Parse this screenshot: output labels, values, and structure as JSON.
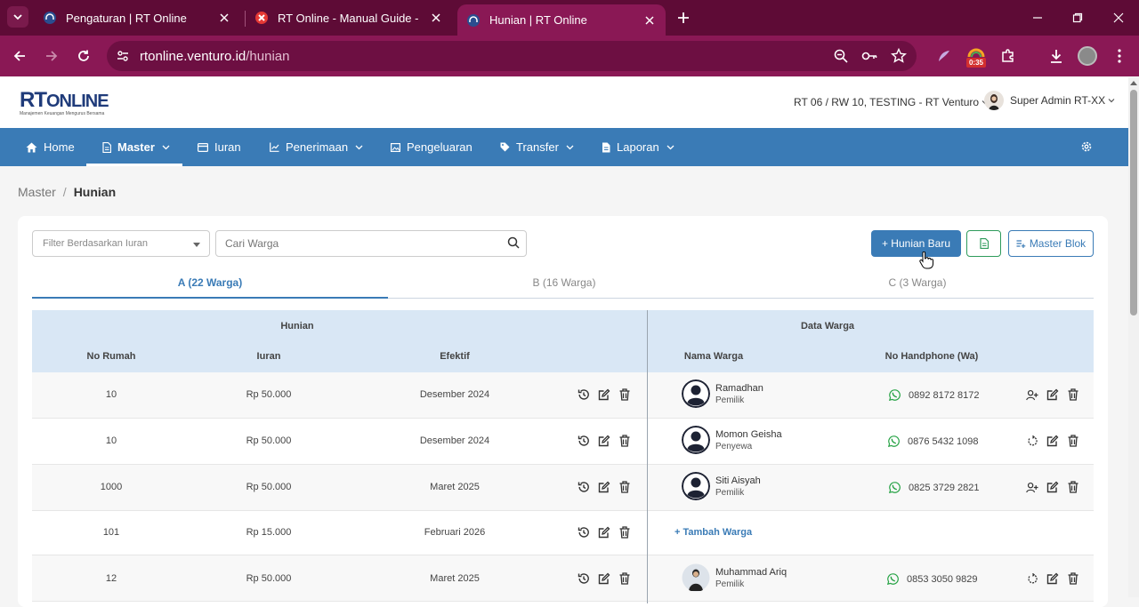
{
  "browser": {
    "tabs": [
      {
        "title": "Pengaturan | RT Online",
        "active": false
      },
      {
        "title": "RT Online - Manual Guide - Xm",
        "active": false
      },
      {
        "title": "Hunian | RT Online",
        "active": true
      }
    ],
    "url_host": "rtonline.venturo.id",
    "url_path": "/hunian",
    "timer_badge": "0:35"
  },
  "header": {
    "logo_text": "RT",
    "logo_text2": "ONLINE",
    "logo_tagline": "Manajemen Keuangan Mengurus Bersama",
    "rt_selector": "RT 06 / RW 10, TESTING - RT Venturo",
    "user_name": "Super Admin RT-XX"
  },
  "nav": {
    "items": [
      {
        "label": "Home"
      },
      {
        "label": "Master"
      },
      {
        "label": "Iuran"
      },
      {
        "label": "Penerimaan"
      },
      {
        "label": "Pengeluaran"
      },
      {
        "label": "Transfer"
      },
      {
        "label": "Laporan"
      }
    ]
  },
  "breadcrumb": {
    "parent": "Master",
    "separator": "/",
    "current": "Hunian"
  },
  "toolbar": {
    "filter_placeholder": "Filter Berdasarkan Iuran",
    "search_placeholder": "Cari Warga",
    "add_button": "+ Hunian Baru",
    "master_blok_button": "Master Blok"
  },
  "blok_tabs": [
    {
      "label": "A (22 Warga)",
      "active": true
    },
    {
      "label": "B (16 Warga)",
      "active": false
    },
    {
      "label": "C (3 Warga)",
      "active": false
    }
  ],
  "table": {
    "group_hunian": "Hunian",
    "group_warga": "Data Warga",
    "col_no_rumah": "No Rumah",
    "col_iuran": "Iuran",
    "col_efektif": "Efektif",
    "col_nama": "Nama Warga",
    "col_hp": "No Handphone (Wa)",
    "add_warga_label": "+ Tambah Warga",
    "rows": [
      {
        "no": "10",
        "iuran": "Rp 50.000",
        "efektif": "Desember 2024",
        "nama": "Ramadhan",
        "role": "Pemilik",
        "hp": "0892 8172 8172"
      },
      {
        "no": "10",
        "iuran": "Rp 50.000",
        "efektif": "Desember 2024",
        "nama": "Momon Geisha",
        "role": "Penyewa",
        "hp": "0876 5432 1098"
      },
      {
        "no": "1000",
        "iuran": "Rp 50.000",
        "efektif": "Maret 2025",
        "nama": "Siti Aisyah",
        "role": "Pemilik",
        "hp": "0825 3729 2821"
      },
      {
        "no": "101",
        "iuran": "Rp 15.000",
        "efektif": "Februari 2026",
        "nama": "",
        "role": "",
        "hp": ""
      },
      {
        "no": "12",
        "iuran": "Rp 50.000",
        "efektif": "Maret 2025",
        "nama": "Muhammad Ariq",
        "role": "Pemilik",
        "hp": "0853 3050 9829"
      }
    ]
  },
  "colors": {
    "primary": "#3a7bb6",
    "browser": "#8a1855",
    "whatsapp": "#25a244"
  }
}
